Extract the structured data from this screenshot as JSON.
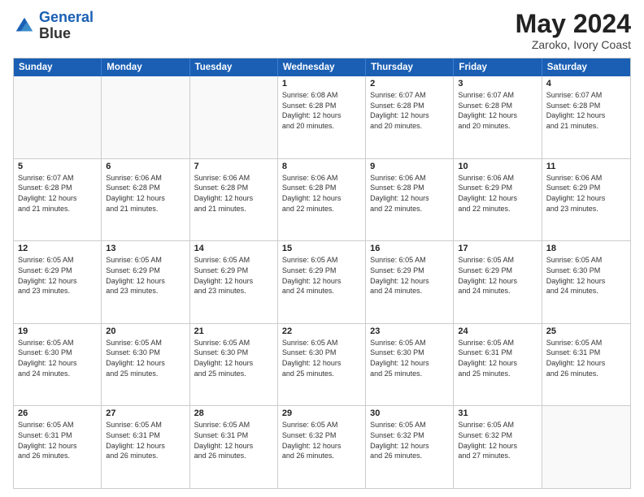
{
  "header": {
    "logo_line1": "General",
    "logo_line2": "Blue",
    "month": "May 2024",
    "location": "Zaroko, Ivory Coast"
  },
  "days_of_week": [
    "Sunday",
    "Monday",
    "Tuesday",
    "Wednesday",
    "Thursday",
    "Friday",
    "Saturday"
  ],
  "weeks": [
    [
      {
        "day": "",
        "empty": true
      },
      {
        "day": "",
        "empty": true
      },
      {
        "day": "",
        "empty": true
      },
      {
        "day": "1",
        "text": "Sunrise: 6:08 AM\nSunset: 6:28 PM\nDaylight: 12 hours\nand 20 minutes."
      },
      {
        "day": "2",
        "text": "Sunrise: 6:07 AM\nSunset: 6:28 PM\nDaylight: 12 hours\nand 20 minutes."
      },
      {
        "day": "3",
        "text": "Sunrise: 6:07 AM\nSunset: 6:28 PM\nDaylight: 12 hours\nand 20 minutes."
      },
      {
        "day": "4",
        "text": "Sunrise: 6:07 AM\nSunset: 6:28 PM\nDaylight: 12 hours\nand 21 minutes."
      }
    ],
    [
      {
        "day": "5",
        "text": "Sunrise: 6:07 AM\nSunset: 6:28 PM\nDaylight: 12 hours\nand 21 minutes."
      },
      {
        "day": "6",
        "text": "Sunrise: 6:06 AM\nSunset: 6:28 PM\nDaylight: 12 hours\nand 21 minutes."
      },
      {
        "day": "7",
        "text": "Sunrise: 6:06 AM\nSunset: 6:28 PM\nDaylight: 12 hours\nand 21 minutes."
      },
      {
        "day": "8",
        "text": "Sunrise: 6:06 AM\nSunset: 6:28 PM\nDaylight: 12 hours\nand 22 minutes."
      },
      {
        "day": "9",
        "text": "Sunrise: 6:06 AM\nSunset: 6:28 PM\nDaylight: 12 hours\nand 22 minutes."
      },
      {
        "day": "10",
        "text": "Sunrise: 6:06 AM\nSunset: 6:29 PM\nDaylight: 12 hours\nand 22 minutes."
      },
      {
        "day": "11",
        "text": "Sunrise: 6:06 AM\nSunset: 6:29 PM\nDaylight: 12 hours\nand 23 minutes."
      }
    ],
    [
      {
        "day": "12",
        "text": "Sunrise: 6:05 AM\nSunset: 6:29 PM\nDaylight: 12 hours\nand 23 minutes."
      },
      {
        "day": "13",
        "text": "Sunrise: 6:05 AM\nSunset: 6:29 PM\nDaylight: 12 hours\nand 23 minutes."
      },
      {
        "day": "14",
        "text": "Sunrise: 6:05 AM\nSunset: 6:29 PM\nDaylight: 12 hours\nand 23 minutes."
      },
      {
        "day": "15",
        "text": "Sunrise: 6:05 AM\nSunset: 6:29 PM\nDaylight: 12 hours\nand 24 minutes."
      },
      {
        "day": "16",
        "text": "Sunrise: 6:05 AM\nSunset: 6:29 PM\nDaylight: 12 hours\nand 24 minutes."
      },
      {
        "day": "17",
        "text": "Sunrise: 6:05 AM\nSunset: 6:29 PM\nDaylight: 12 hours\nand 24 minutes."
      },
      {
        "day": "18",
        "text": "Sunrise: 6:05 AM\nSunset: 6:30 PM\nDaylight: 12 hours\nand 24 minutes."
      }
    ],
    [
      {
        "day": "19",
        "text": "Sunrise: 6:05 AM\nSunset: 6:30 PM\nDaylight: 12 hours\nand 24 minutes."
      },
      {
        "day": "20",
        "text": "Sunrise: 6:05 AM\nSunset: 6:30 PM\nDaylight: 12 hours\nand 25 minutes."
      },
      {
        "day": "21",
        "text": "Sunrise: 6:05 AM\nSunset: 6:30 PM\nDaylight: 12 hours\nand 25 minutes."
      },
      {
        "day": "22",
        "text": "Sunrise: 6:05 AM\nSunset: 6:30 PM\nDaylight: 12 hours\nand 25 minutes."
      },
      {
        "day": "23",
        "text": "Sunrise: 6:05 AM\nSunset: 6:30 PM\nDaylight: 12 hours\nand 25 minutes."
      },
      {
        "day": "24",
        "text": "Sunrise: 6:05 AM\nSunset: 6:31 PM\nDaylight: 12 hours\nand 25 minutes."
      },
      {
        "day": "25",
        "text": "Sunrise: 6:05 AM\nSunset: 6:31 PM\nDaylight: 12 hours\nand 26 minutes."
      }
    ],
    [
      {
        "day": "26",
        "text": "Sunrise: 6:05 AM\nSunset: 6:31 PM\nDaylight: 12 hours\nand 26 minutes."
      },
      {
        "day": "27",
        "text": "Sunrise: 6:05 AM\nSunset: 6:31 PM\nDaylight: 12 hours\nand 26 minutes."
      },
      {
        "day": "28",
        "text": "Sunrise: 6:05 AM\nSunset: 6:31 PM\nDaylight: 12 hours\nand 26 minutes."
      },
      {
        "day": "29",
        "text": "Sunrise: 6:05 AM\nSunset: 6:32 PM\nDaylight: 12 hours\nand 26 minutes."
      },
      {
        "day": "30",
        "text": "Sunrise: 6:05 AM\nSunset: 6:32 PM\nDaylight: 12 hours\nand 26 minutes."
      },
      {
        "day": "31",
        "text": "Sunrise: 6:05 AM\nSunset: 6:32 PM\nDaylight: 12 hours\nand 27 minutes."
      },
      {
        "day": "",
        "empty": true
      }
    ]
  ]
}
